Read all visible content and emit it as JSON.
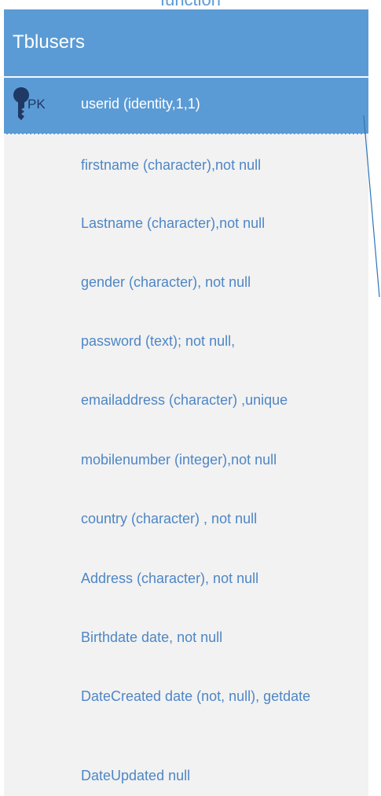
{
  "top_label": "function",
  "entity": {
    "title": "Tblusers",
    "pk": {
      "label": "PK",
      "field": "userid (identity,1,1)"
    },
    "fields": [
      "firstname (character),not null",
      "Lastname (character),not null",
      "gender (character), not null",
      "password (text); not null,",
      "emailaddress (character) ,unique",
      "mobilenumber (integer),not null",
      "country (character) , not null",
      "Address (character), not null",
      "Birthdate date, not null",
      "DateCreated date (not, null), getdate",
      "DateUpdated null"
    ]
  },
  "colors": {
    "header": "#5b9bd5",
    "body": "#f2f2f2",
    "field_text": "#4e86c6",
    "pk_label": "#1f3864",
    "key_icon": "#1f3864",
    "connector": "#2e75b6"
  },
  "icons": {
    "key": "key-icon"
  }
}
